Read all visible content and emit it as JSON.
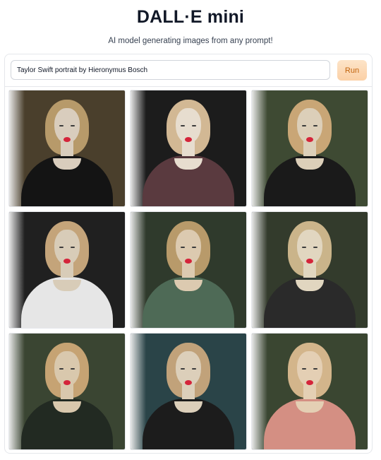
{
  "app": {
    "title": "DALL·E mini",
    "subtitle": "AI model generating images from any prompt!"
  },
  "prompt": {
    "value": "Taylor Swift portrait by Hieronymus Bosch"
  },
  "run_button": {
    "label": "Run"
  },
  "gallery": {
    "tiles": [
      {
        "bg": "#4a3f2c",
        "hair": "#b79a6a",
        "skin": "#d9cdbd",
        "dress": "#141414"
      },
      {
        "bg": "#1c1c1c",
        "hair": "#d2b894",
        "skin": "#e7ddcf",
        "dress": "#5a3a3f"
      },
      {
        "bg": "#3e4a33",
        "hair": "#c9a676",
        "skin": "#dccfb9",
        "dress": "#1a1a1a"
      },
      {
        "bg": "#202020",
        "hair": "#c4a47a",
        "skin": "#d8ccb8",
        "dress": "#e6e6e6"
      },
      {
        "bg": "#2f3a2c",
        "hair": "#b89a6a",
        "skin": "#dccab0",
        "dress": "#4e6a56"
      },
      {
        "bg": "#333b2c",
        "hair": "#cab48a",
        "skin": "#e1d6c0",
        "dress": "#2a2a2a"
      },
      {
        "bg": "#3a4532",
        "hair": "#c6a373",
        "skin": "#d9c8ad",
        "dress": "#222a22"
      },
      {
        "bg": "#2a4448",
        "hair": "#c1a27a",
        "skin": "#dccfba",
        "dress": "#1c1c1c"
      },
      {
        "bg": "#3a4631",
        "hair": "#d3b58b",
        "skin": "#e4cfb4",
        "dress": "#d48f83"
      }
    ]
  }
}
